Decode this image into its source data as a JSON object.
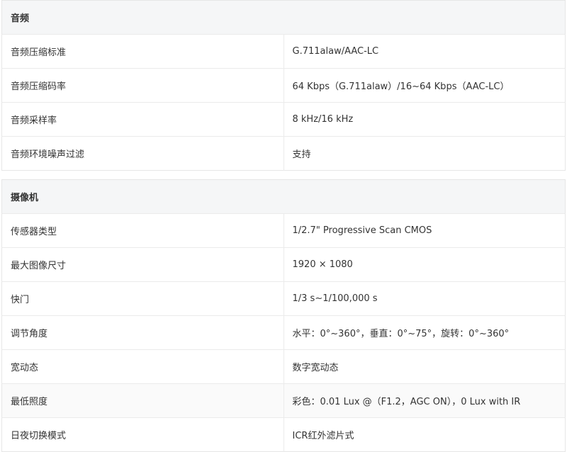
{
  "sections": [
    {
      "title": "音频",
      "rows": [
        {
          "label": "音频压缩标准",
          "value": "G.711alaw/AAC-LC"
        },
        {
          "label": "音频压缩码率",
          "value": "64 Kbps（G.711alaw）/16~64 Kbps（AAC-LC）"
        },
        {
          "label": "音频采样率",
          "value": "8 kHz/16 kHz"
        },
        {
          "label": "音频环境噪声过滤",
          "value": "支持"
        }
      ]
    },
    {
      "title": "摄像机",
      "rows": [
        {
          "label": "传感器类型",
          "value": "1/2.7\" Progressive Scan CMOS"
        },
        {
          "label": "最大图像尺寸",
          "value": "1920 × 1080"
        },
        {
          "label": "快门",
          "value": "1/3 s~1/100,000 s"
        },
        {
          "label": "调节角度",
          "value": "水平：0°~360°，垂直：0°~75°，旋转：0°~360°"
        },
        {
          "label": "宽动态",
          "value": "数字宽动态"
        },
        {
          "label": "最低照度",
          "value": "彩色：0.01 Lux @（F1.2，AGC ON），0 Lux with IR"
        },
        {
          "label": "日夜切换模式",
          "value": "ICR红外滤片式"
        }
      ]
    }
  ]
}
